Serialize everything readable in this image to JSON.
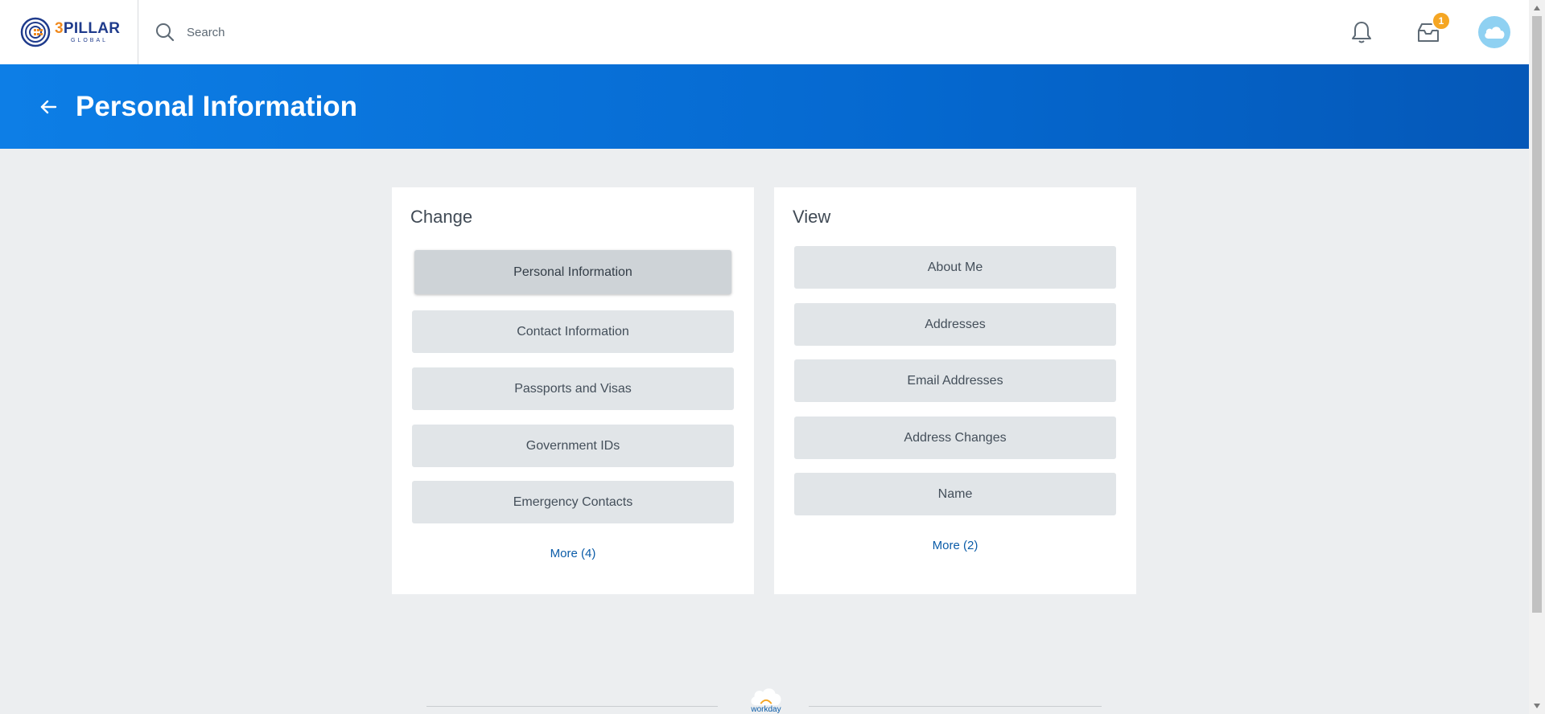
{
  "app": {
    "logo": {
      "main_number": "3",
      "main_text": "PILLAR",
      "sub_text": "GLOBAL"
    },
    "search": {
      "placeholder": "Search"
    },
    "notifications": {
      "icon": "bell-icon"
    },
    "inbox": {
      "icon": "inbox-icon",
      "badge_count": "1"
    },
    "profile": {
      "icon": "cloud-icon",
      "color": "#8fd1f2"
    }
  },
  "header": {
    "title": "Personal Information",
    "back_icon": "arrow-left-icon",
    "colors": {
      "start": "#0d7ee6",
      "end": "#0558b8"
    }
  },
  "change_card": {
    "title": "Change",
    "actions": [
      {
        "label": "Personal Information",
        "active": true
      },
      {
        "label": "Contact Information"
      },
      {
        "label": "Passports and Visas"
      },
      {
        "label": "Government IDs"
      },
      {
        "label": "Emergency Contacts"
      }
    ],
    "more_label": "More (4)"
  },
  "view_card": {
    "title": "View",
    "actions": [
      {
        "label": "About Me"
      },
      {
        "label": "Addresses"
      },
      {
        "label": "Email Addresses"
      },
      {
        "label": "Address Changes"
      },
      {
        "label": "Name"
      }
    ],
    "more_label": "More (2)"
  },
  "footer": {
    "brand": "workday"
  },
  "colors": {
    "page_bg": "#eceef0",
    "button_bg": "#e1e5e8",
    "active_button_bg": "#ced3d7",
    "link": "#0b5ca8",
    "badge": "#f5a623"
  }
}
